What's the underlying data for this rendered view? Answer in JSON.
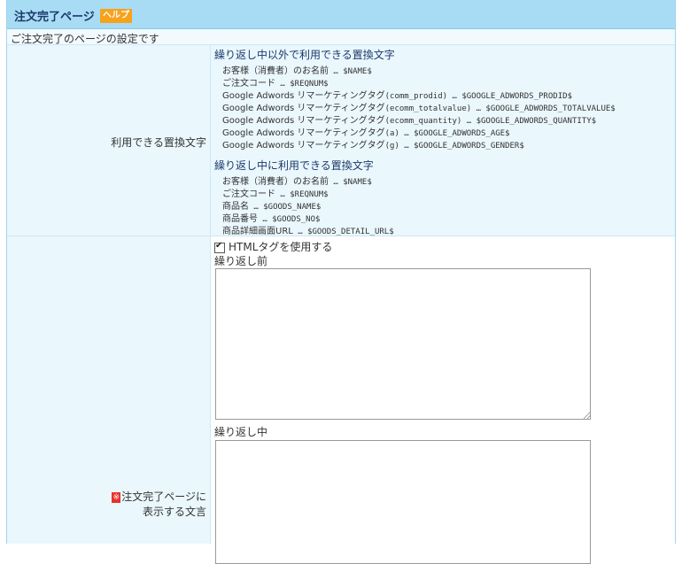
{
  "header": {
    "title": "注文完了ページ",
    "help_label": "ヘルプ"
  },
  "description": "ご注文完了のページの設定です",
  "placeholders_section": {
    "label": "利用できる置換文字",
    "outside_loop": {
      "heading": "繰り返し中以外で利用できる置換文字",
      "items": [
        {
          "jp": "お客様（消費者）のお名前",
          "code": " … $NAME$"
        },
        {
          "jp": "ご注文コード",
          "code": " … $REQNUM$"
        },
        {
          "jp": "Google Adwords リマーケティングタグ",
          "code": "(comm_prodid) … $GOOGLE_ADWORDS_PRODID$"
        },
        {
          "jp": "Google Adwords リマーケティングタグ",
          "code": "(ecomm_totalvalue) … $GOOGLE_ADWORDS_TOTALVALUE$"
        },
        {
          "jp": "Google Adwords リマーケティングタグ",
          "code": "(ecomm_quantity) … $GOOGLE_ADWORDS_QUANTITY$"
        },
        {
          "jp": "Google Adwords リマーケティングタグ",
          "code": "(a) … $GOOGLE_ADWORDS_AGE$"
        },
        {
          "jp": "Google Adwords リマーケティングタグ",
          "code": "(g) … $GOOGLE_ADWORDS_GENDER$"
        }
      ]
    },
    "inside_loop": {
      "heading": "繰り返し中に利用できる置換文字",
      "items": [
        {
          "jp": "お客様（消費者）のお名前",
          "code": " … $NAME$"
        },
        {
          "jp": "ご注文コード",
          "code": " … $REQNUM$"
        },
        {
          "jp": "商品名",
          "code": " … $GOODS_NAME$"
        },
        {
          "jp": "商品番号",
          "code": " … $GOODS_NO$"
        },
        {
          "jp": "商品詳細画面URL",
          "code": " … $GOODS_DETAIL_URL$"
        }
      ]
    }
  },
  "message_section": {
    "required_mark": "※",
    "label_line1": "注文完了ページに",
    "label_line2": "表示する文言",
    "use_html_label": "HTMLタグを使用する",
    "use_html_checked": true,
    "before_loop_label": "繰り返し前",
    "before_loop_value": "",
    "in_loop_label": "繰り返し中",
    "in_loop_value": ""
  },
  "colors": {
    "header_bg": "#a8dcf5",
    "label_bg": "#eaf7fd",
    "help_badge": "#f7a21b",
    "required_mark": "#e8322a"
  }
}
